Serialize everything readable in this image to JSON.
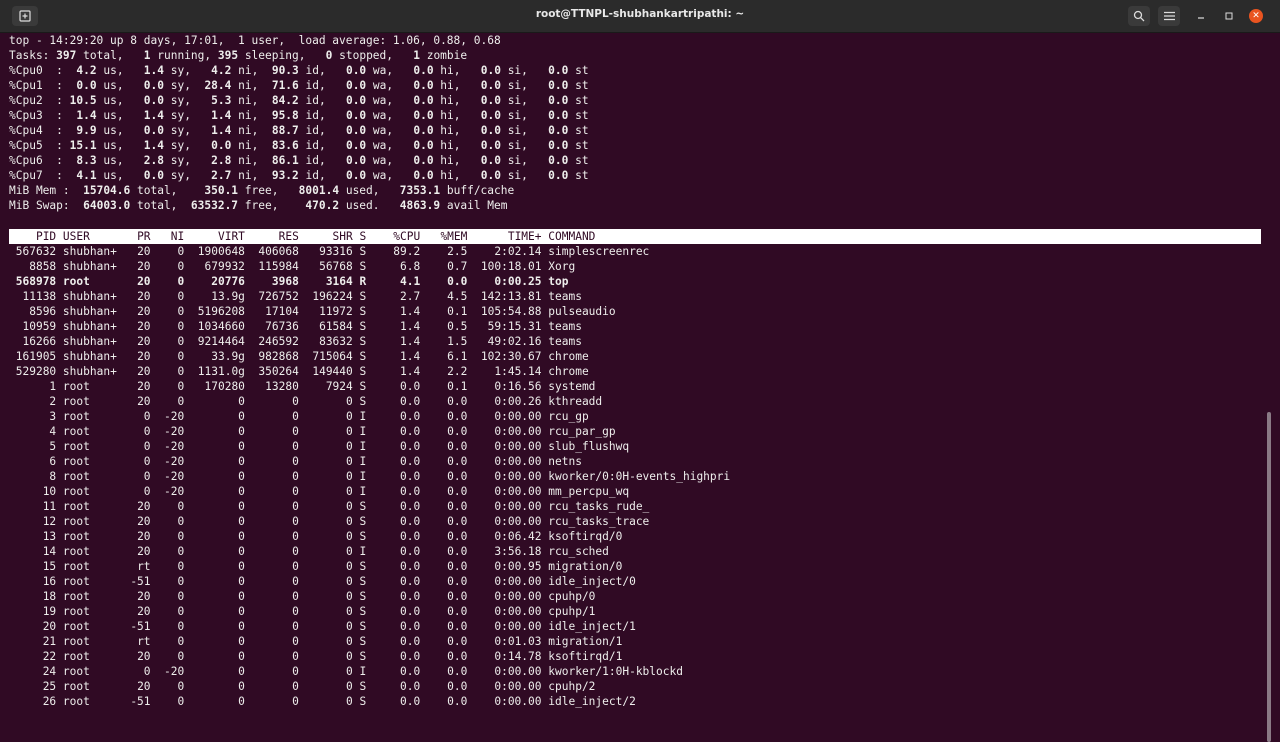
{
  "window": {
    "title": "root@TTNPL-shubhankartripathi: ~",
    "icons": {
      "new_tab": "new-tab-icon",
      "search": "search-icon",
      "menu": "hamburger-menu-icon",
      "minimize": "minimize-icon",
      "maximize": "maximize-icon",
      "close": "close-icon"
    }
  },
  "summary": {
    "uptime": "top - 14:29:20 up 8 days, 17:01,  1 user,  load average: 1.06, 0.88, 0.68",
    "tasks": {
      "label": "Tasks:",
      "total": "397",
      "running": "1",
      "sleeping": "395",
      "stopped": "0",
      "zombie": "1"
    },
    "cpus": [
      {
        "name": "%Cpu0",
        "us": "4.2",
        "sy": "1.4",
        "ni": "4.2",
        "id": "90.3",
        "wa": "0.0",
        "hi": "0.0",
        "si": "0.0",
        "st": "0.0"
      },
      {
        "name": "%Cpu1",
        "us": "0.0",
        "sy": "0.0",
        "ni": "28.4",
        "id": "71.6",
        "wa": "0.0",
        "hi": "0.0",
        "si": "0.0",
        "st": "0.0"
      },
      {
        "name": "%Cpu2",
        "us": "10.5",
        "sy": "0.0",
        "ni": "5.3",
        "id": "84.2",
        "wa": "0.0",
        "hi": "0.0",
        "si": "0.0",
        "st": "0.0"
      },
      {
        "name": "%Cpu3",
        "us": "1.4",
        "sy": "1.4",
        "ni": "1.4",
        "id": "95.8",
        "wa": "0.0",
        "hi": "0.0",
        "si": "0.0",
        "st": "0.0"
      },
      {
        "name": "%Cpu4",
        "us": "9.9",
        "sy": "0.0",
        "ni": "1.4",
        "id": "88.7",
        "wa": "0.0",
        "hi": "0.0",
        "si": "0.0",
        "st": "0.0"
      },
      {
        "name": "%Cpu5",
        "us": "15.1",
        "sy": "1.4",
        "ni": "0.0",
        "id": "83.6",
        "wa": "0.0",
        "hi": "0.0",
        "si": "0.0",
        "st": "0.0"
      },
      {
        "name": "%Cpu6",
        "us": "8.3",
        "sy": "2.8",
        "ni": "2.8",
        "id": "86.1",
        "wa": "0.0",
        "hi": "0.0",
        "si": "0.0",
        "st": "0.0"
      },
      {
        "name": "%Cpu7",
        "us": "4.1",
        "sy": "0.0",
        "ni": "2.7",
        "id": "93.2",
        "wa": "0.0",
        "hi": "0.0",
        "si": "0.0",
        "st": "0.0"
      }
    ],
    "mem": {
      "label": "MiB Mem :",
      "total": "15704.6",
      "free": "350.1",
      "used": "8001.4",
      "buff_cache": "7353.1"
    },
    "swap": {
      "label": "MiB Swap:",
      "total": "64003.0",
      "free": "63532.7",
      "used": "470.2",
      "avail": "4863.9"
    }
  },
  "columns": [
    "PID",
    "USER",
    "PR",
    "NI",
    "VIRT",
    "RES",
    "SHR",
    "S",
    "%CPU",
    "%MEM",
    "TIME+",
    "COMMAND"
  ],
  "processes": [
    [
      "567632",
      "shubhan+",
      "20",
      "0",
      "1900648",
      "406068",
      "93316",
      "S",
      "89.2",
      "2.5",
      "2:02.14",
      "simplescreenrec"
    ],
    [
      "8858",
      "shubhan+",
      "20",
      "0",
      "679932",
      "115984",
      "56768",
      "S",
      "6.8",
      "0.7",
      "100:18.01",
      "Xorg"
    ],
    [
      "568978",
      "root",
      "20",
      "0",
      "20776",
      "3968",
      "3164",
      "R",
      "4.1",
      "0.0",
      "0:00.25",
      "top"
    ],
    [
      "11138",
      "shubhan+",
      "20",
      "0",
      "13.9g",
      "726752",
      "196224",
      "S",
      "2.7",
      "4.5",
      "142:13.81",
      "teams"
    ],
    [
      "8596",
      "shubhan+",
      "20",
      "0",
      "5196208",
      "17104",
      "11972",
      "S",
      "1.4",
      "0.1",
      "105:54.88",
      "pulseaudio"
    ],
    [
      "10959",
      "shubhan+",
      "20",
      "0",
      "1034660",
      "76736",
      "61584",
      "S",
      "1.4",
      "0.5",
      "59:15.31",
      "teams"
    ],
    [
      "16266",
      "shubhan+",
      "20",
      "0",
      "9214464",
      "246592",
      "83632",
      "S",
      "1.4",
      "1.5",
      "49:02.16",
      "teams"
    ],
    [
      "161905",
      "shubhan+",
      "20",
      "0",
      "33.9g",
      "982868",
      "715064",
      "S",
      "1.4",
      "6.1",
      "102:30.67",
      "chrome"
    ],
    [
      "529280",
      "shubhan+",
      "20",
      "0",
      "1131.0g",
      "350264",
      "149440",
      "S",
      "1.4",
      "2.2",
      "1:45.14",
      "chrome"
    ],
    [
      "1",
      "root",
      "20",
      "0",
      "170280",
      "13280",
      "7924",
      "S",
      "0.0",
      "0.1",
      "0:16.56",
      "systemd"
    ],
    [
      "2",
      "root",
      "20",
      "0",
      "0",
      "0",
      "0",
      "S",
      "0.0",
      "0.0",
      "0:00.26",
      "kthreadd"
    ],
    [
      "3",
      "root",
      "0",
      "-20",
      "0",
      "0",
      "0",
      "I",
      "0.0",
      "0.0",
      "0:00.00",
      "rcu_gp"
    ],
    [
      "4",
      "root",
      "0",
      "-20",
      "0",
      "0",
      "0",
      "I",
      "0.0",
      "0.0",
      "0:00.00",
      "rcu_par_gp"
    ],
    [
      "5",
      "root",
      "0",
      "-20",
      "0",
      "0",
      "0",
      "I",
      "0.0",
      "0.0",
      "0:00.00",
      "slub_flushwq"
    ],
    [
      "6",
      "root",
      "0",
      "-20",
      "0",
      "0",
      "0",
      "I",
      "0.0",
      "0.0",
      "0:00.00",
      "netns"
    ],
    [
      "8",
      "root",
      "0",
      "-20",
      "0",
      "0",
      "0",
      "I",
      "0.0",
      "0.0",
      "0:00.00",
      "kworker/0:0H-events_highpri"
    ],
    [
      "10",
      "root",
      "0",
      "-20",
      "0",
      "0",
      "0",
      "I",
      "0.0",
      "0.0",
      "0:00.00",
      "mm_percpu_wq"
    ],
    [
      "11",
      "root",
      "20",
      "0",
      "0",
      "0",
      "0",
      "S",
      "0.0",
      "0.0",
      "0:00.00",
      "rcu_tasks_rude_"
    ],
    [
      "12",
      "root",
      "20",
      "0",
      "0",
      "0",
      "0",
      "S",
      "0.0",
      "0.0",
      "0:00.00",
      "rcu_tasks_trace"
    ],
    [
      "13",
      "root",
      "20",
      "0",
      "0",
      "0",
      "0",
      "S",
      "0.0",
      "0.0",
      "0:06.42",
      "ksoftirqd/0"
    ],
    [
      "14",
      "root",
      "20",
      "0",
      "0",
      "0",
      "0",
      "I",
      "0.0",
      "0.0",
      "3:56.18",
      "rcu_sched"
    ],
    [
      "15",
      "root",
      "rt",
      "0",
      "0",
      "0",
      "0",
      "S",
      "0.0",
      "0.0",
      "0:00.95",
      "migration/0"
    ],
    [
      "16",
      "root",
      "-51",
      "0",
      "0",
      "0",
      "0",
      "S",
      "0.0",
      "0.0",
      "0:00.00",
      "idle_inject/0"
    ],
    [
      "18",
      "root",
      "20",
      "0",
      "0",
      "0",
      "0",
      "S",
      "0.0",
      "0.0",
      "0:00.00",
      "cpuhp/0"
    ],
    [
      "19",
      "root",
      "20",
      "0",
      "0",
      "0",
      "0",
      "S",
      "0.0",
      "0.0",
      "0:00.00",
      "cpuhp/1"
    ],
    [
      "20",
      "root",
      "-51",
      "0",
      "0",
      "0",
      "0",
      "S",
      "0.0",
      "0.0",
      "0:00.00",
      "idle_inject/1"
    ],
    [
      "21",
      "root",
      "rt",
      "0",
      "0",
      "0",
      "0",
      "S",
      "0.0",
      "0.0",
      "0:01.03",
      "migration/1"
    ],
    [
      "22",
      "root",
      "20",
      "0",
      "0",
      "0",
      "0",
      "S",
      "0.0",
      "0.0",
      "0:14.78",
      "ksoftirqd/1"
    ],
    [
      "24",
      "root",
      "0",
      "-20",
      "0",
      "0",
      "0",
      "I",
      "0.0",
      "0.0",
      "0:00.00",
      "kworker/1:0H-kblockd"
    ],
    [
      "25",
      "root",
      "20",
      "0",
      "0",
      "0",
      "0",
      "S",
      "0.0",
      "0.0",
      "0:00.00",
      "cpuhp/2"
    ],
    [
      "26",
      "root",
      "-51",
      "0",
      "0",
      "0",
      "0",
      "S",
      "0.0",
      "0.0",
      "0:00.00",
      "idle_inject/2"
    ]
  ],
  "colors": {
    "terminal_bg": "#300a24",
    "text": "#eeeeec",
    "header_bg": "#ffffff",
    "close_button": "#e95420"
  }
}
